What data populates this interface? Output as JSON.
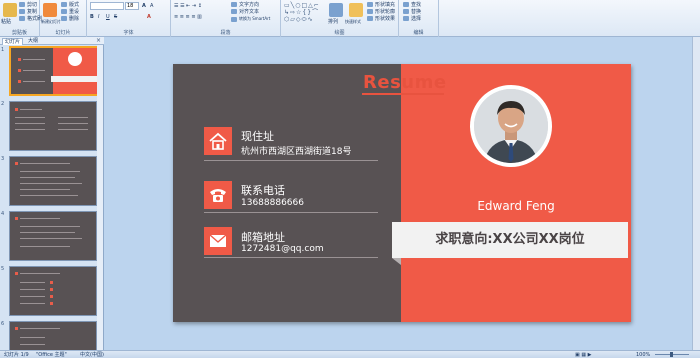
{
  "ribbon": {
    "groups": [
      {
        "label": "剪贴板"
      },
      {
        "label": "幻灯片"
      },
      {
        "label": "字体"
      },
      {
        "label": "段落"
      },
      {
        "label": "绘图"
      },
      {
        "label": "编辑"
      }
    ],
    "buttons": {
      "cut": "剪切",
      "copy": "复制",
      "format_painter": "格式刷",
      "paste": "粘贴",
      "new_slide": "新建幻灯片",
      "layout": "版式",
      "reset": "重设",
      "delete": "删除",
      "text_direction": "文字方向",
      "align_text": "对齐文本",
      "smartart": "转换为 SmartArt",
      "arrange": "排列",
      "quick_styles": "快速样式",
      "shape_fill": "形状填充",
      "shape_outline": "形状轮廓",
      "shape_effects": "形状效果",
      "find": "查找",
      "replace": "替换",
      "select": "选择"
    },
    "font_size": "18"
  },
  "left_panel": {
    "tabs": [
      "幻灯片",
      "大纲"
    ],
    "thumb_numbers": [
      "1",
      "2",
      "3",
      "4",
      "5",
      "6"
    ]
  },
  "slide": {
    "title": "Resume",
    "address_label": "现住址",
    "address_value": "杭州市西湖区西湖街道18号",
    "phone_label": "联系电话",
    "phone_value": "13688886666",
    "email_label": "邮箱地址",
    "email_value": "1272481@qq.com",
    "name": "Edward Feng",
    "intent": "求职意向:XX公司XX岗位"
  },
  "status_bar": {
    "slide_count": "幻灯片 1/9",
    "theme": "\"Office 主题\"",
    "language": "中文(中国)",
    "zoom": "100%"
  },
  "colors": {
    "accent": "#f05a47",
    "dark": "#585254",
    "title_red": "#e8533f",
    "intent_bg": "#f2f2f2",
    "ribbon_bg": "#dde8f5",
    "workspace_bg": "#bcd4ee"
  }
}
